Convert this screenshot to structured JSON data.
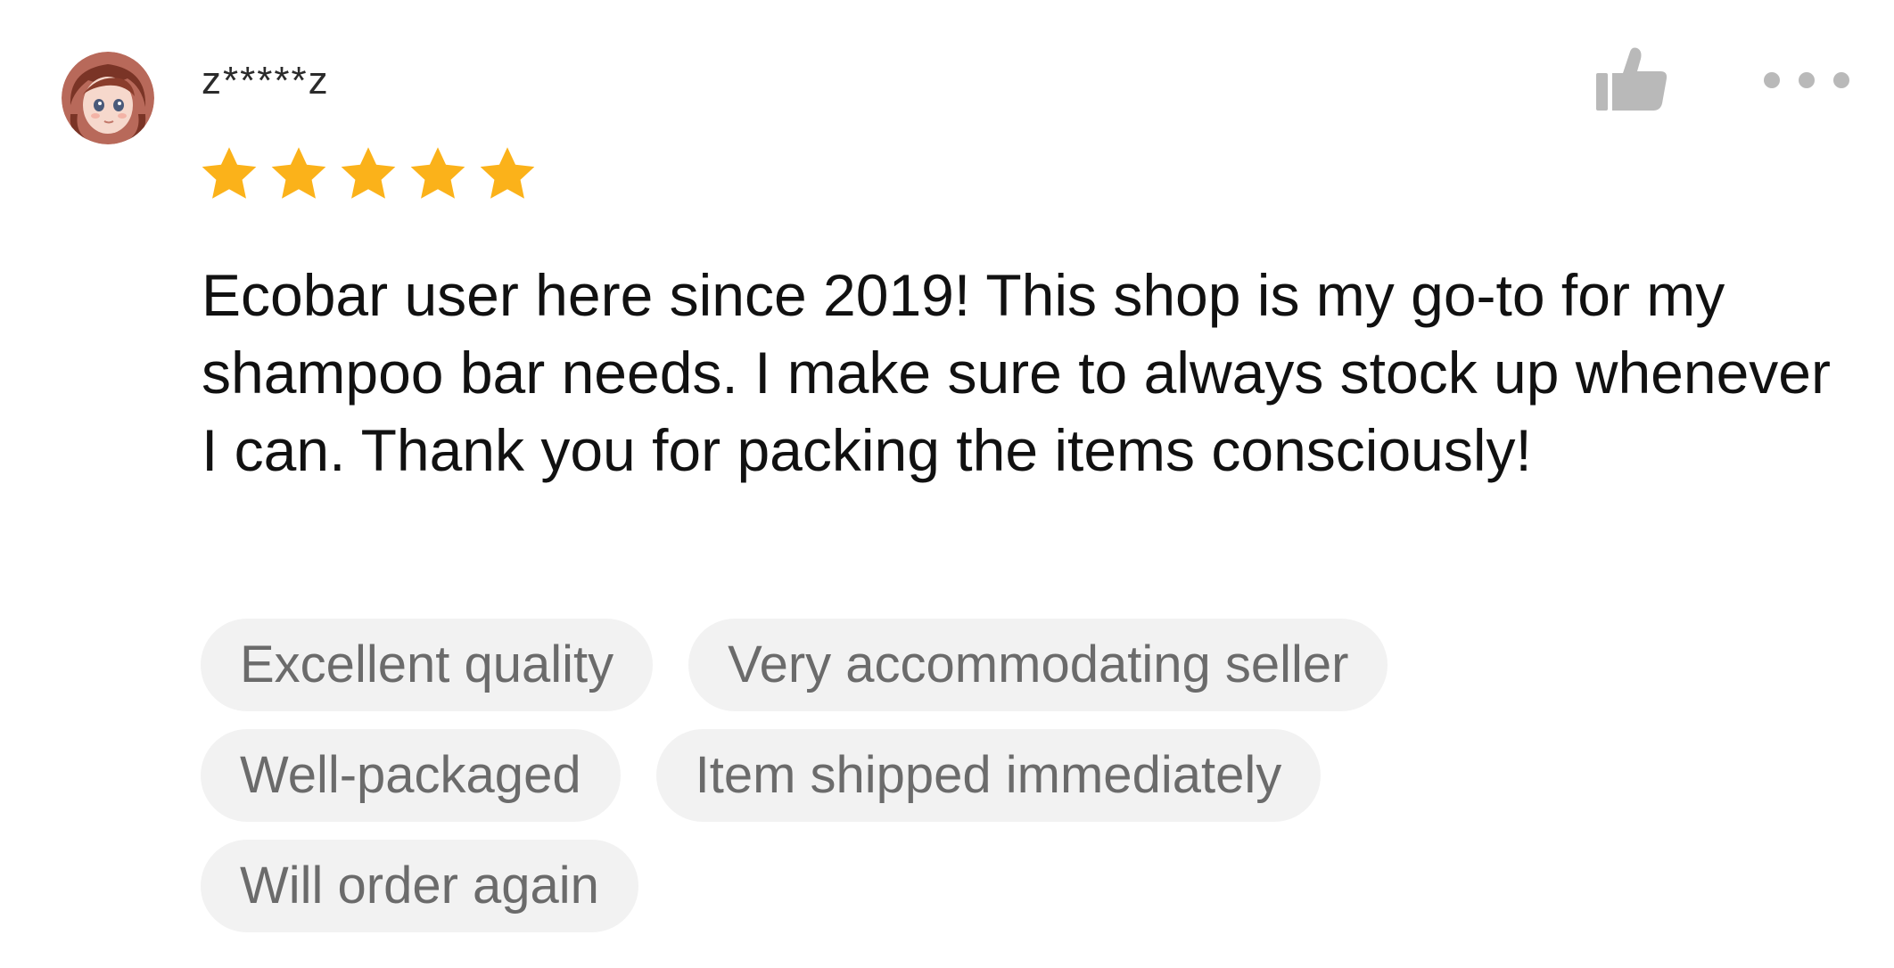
{
  "review": {
    "username": "z*****z",
    "rating": 5,
    "rating_max": 5,
    "text": "Ecobar user here since 2019! This shop is my go-to for my shampoo bar needs. I make sure to always stock up whenever I can. Thank you for packing the items consciously!",
    "tags": [
      [
        "Excellent quality",
        "Very accommodating seller"
      ],
      [
        "Well-packaged",
        "Item shipped immediately"
      ],
      [
        "Will order again"
      ]
    ]
  },
  "icons": {
    "like": "thumbs-up-icon",
    "more": "more-options-icon",
    "star": "star-icon"
  },
  "colors": {
    "star": "#fbb21a",
    "tag_background": "#f2f2f2",
    "tag_text": "#6b6b6b",
    "icon_gray": "#b9b9b9"
  }
}
